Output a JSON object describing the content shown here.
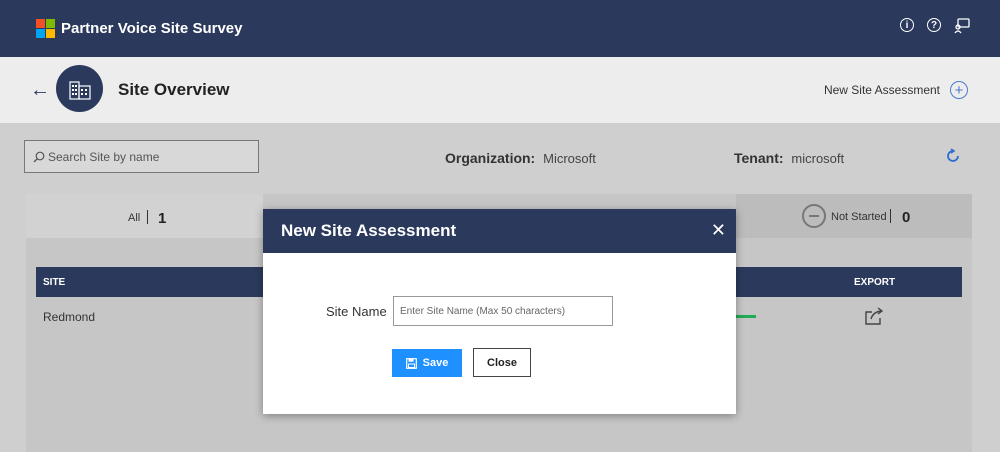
{
  "app": {
    "title": "Partner Voice Site Survey",
    "brand_colors": [
      "#f25022",
      "#7fba00",
      "#00a4ef",
      "#ffb900"
    ],
    "header_icons": [
      "info-icon",
      "help-icon",
      "feedback-icon"
    ]
  },
  "page": {
    "title": "Site Overview",
    "new_site_label": "New Site Assessment"
  },
  "filters": {
    "search_placeholder": "Search Site by name",
    "org_label": "Organization:",
    "org_value": "Microsoft",
    "tenant_label": "Tenant:",
    "tenant_value": "microsoft"
  },
  "tabs": {
    "all_label": "All",
    "all_count": "1",
    "not_started_label": "Not Started",
    "not_started_count": "0"
  },
  "table": {
    "col_site": "SITE",
    "col_export": "EXPORT",
    "rows": [
      {
        "site": "Redmond"
      }
    ]
  },
  "modal": {
    "title": "New Site Assessment",
    "field_label": "Site Name",
    "field_placeholder": "Enter Site Name (Max 50 characters)",
    "field_value": "",
    "save_label": "Save",
    "close_label": "Close"
  },
  "colors": {
    "navy": "#2b3a5c",
    "save_blue": "#1e90ff",
    "accent_blue": "#4a7bd0"
  }
}
